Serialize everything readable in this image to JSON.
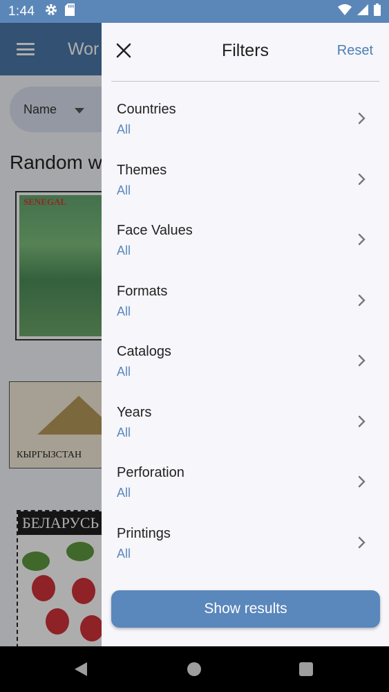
{
  "status_bar": {
    "time": "1:44",
    "icons": [
      "settings-icon",
      "sd-card-icon",
      "wifi-icon",
      "signal-icon",
      "battery-icon"
    ]
  },
  "background_app": {
    "title_partial": "Wor",
    "sort_label": "Name",
    "section_heading_partial": "Random w",
    "stamp1_text": "SENEGAL",
    "stamp2_text": "КЫРГЫЗСТАН",
    "stamp3_text": "БЕЛАРУСЬ"
  },
  "filters_panel": {
    "title": "Filters",
    "reset_label": "Reset",
    "items": [
      {
        "label": "Countries",
        "value": "All"
      },
      {
        "label": "Themes",
        "value": "All"
      },
      {
        "label": "Face Values",
        "value": "All"
      },
      {
        "label": "Formats",
        "value": "All"
      },
      {
        "label": "Catalogs",
        "value": "All"
      },
      {
        "label": "Years",
        "value": "All"
      },
      {
        "label": "Perforation",
        "value": "All"
      },
      {
        "label": "Printings",
        "value": "All"
      }
    ],
    "show_results_label": "Show results"
  },
  "colors": {
    "accent": "#5a87bc",
    "status_bar": "#5b87b8",
    "panel_bg": "#f6f6fb"
  }
}
